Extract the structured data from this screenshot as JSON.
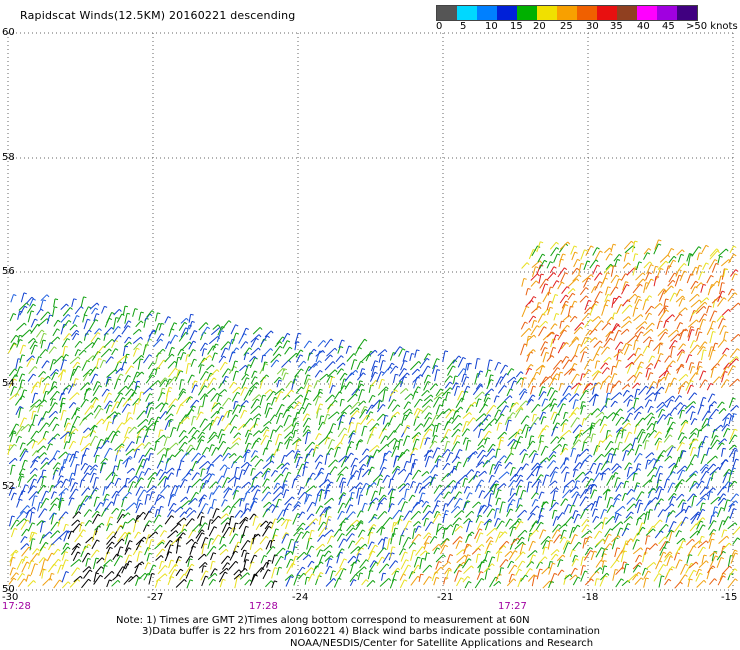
{
  "title": "Rapidscat Winds(12.5KM) 20160221 descending",
  "legend": {
    "colors": [
      "#555555",
      "#00d8ff",
      "#0080ff",
      "#0020d8",
      "#00b000",
      "#f0e000",
      "#f8a000",
      "#f06000",
      "#e81010",
      "#904020",
      "#ff00ff",
      "#a000e0",
      "#400080"
    ],
    "labels": [
      "0",
      "5",
      "10",
      "15",
      "20",
      "25",
      "30",
      "35",
      "40",
      "45",
      ">50 knots"
    ]
  },
  "axes": {
    "lat_ticks": [
      "60",
      "58",
      "56",
      "54",
      "52",
      "50"
    ],
    "lon_ticks": [
      "-30",
      "-27",
      "-24",
      "-21",
      "-18",
      "-15"
    ],
    "time_labels": [
      "17:28",
      "17:28",
      "17:27"
    ],
    "time_color": "#a000a0"
  },
  "notes": {
    "line1": "Note: 1) Times are GMT 2)Times along bottom correspond to measurement at 60N",
    "line2": "3)Data buffer is 22 hrs from 20160221 4) Black wind barbs indicate possible contamination",
    "line3": "NOAA/NESDIS/Center for Satellite Applications and Research"
  },
  "chart_data": {
    "type": "scatter",
    "xlim": [
      -30,
      -15
    ],
    "ylim": [
      50,
      60
    ],
    "grid": "dotted",
    "xlabel": "",
    "ylabel": "",
    "swath_regions": [
      {
        "lon_min": -30,
        "lon_max": -15,
        "lat_min": 50,
        "lat_top_west": 55.6,
        "lat_top_east": 53.6
      },
      {
        "lon_min": -19.4,
        "lon_max": -15,
        "lat_min": 53.8,
        "lat_max": 56.4
      }
    ],
    "wind_speed_zones_knots": [
      {
        "zone": "north swath edge",
        "speed": "15-20"
      },
      {
        "zone": "central swath",
        "speed": "15-25"
      },
      {
        "zone": "southern central",
        "speed": "10-15"
      },
      {
        "zone": "eastern block",
        "speed": "25-35"
      },
      {
        "zone": "southwest corner",
        "speed": "contaminated"
      },
      {
        "zone": "southeast corner",
        "speed": "20-35"
      }
    ]
  }
}
